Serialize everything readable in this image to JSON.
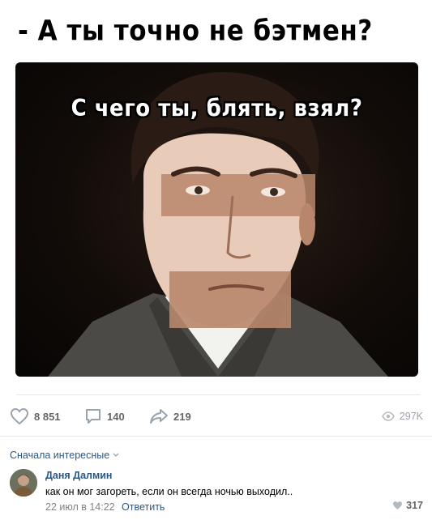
{
  "post": {
    "title": "- А ты точно не бэтмен?",
    "image_caption": "С чего ты, блять, взял?"
  },
  "actions": {
    "likes": "8 851",
    "comments": "140",
    "shares": "219",
    "views": "297K"
  },
  "comments_section": {
    "sort_label": "Сначала интересные",
    "comment": {
      "author": "Даня Далмин",
      "text": "как он мог загореть, если он всегда ночью выходил..",
      "date": "22 июл в 14:22",
      "reply_label": "Ответить",
      "likes": "317"
    }
  },
  "colors": {
    "link": "#2a5885",
    "muted": "#828282",
    "icon": "#99a2ad"
  },
  "icons": [
    "heart-icon",
    "comment-icon",
    "share-icon",
    "eye-icon",
    "chevron-down-icon",
    "small-heart-icon"
  ]
}
